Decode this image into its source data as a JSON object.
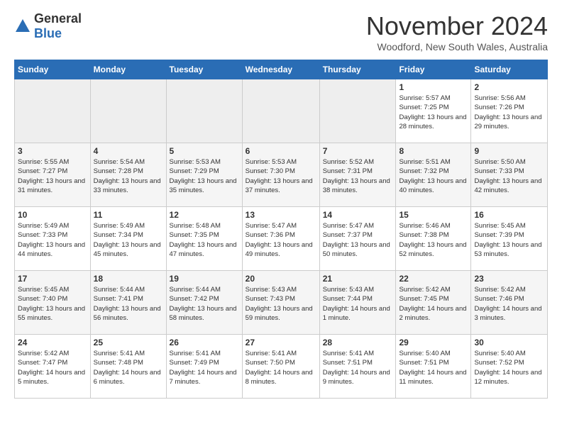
{
  "header": {
    "logo_general": "General",
    "logo_blue": "Blue",
    "month_title": "November 2024",
    "subtitle": "Woodford, New South Wales, Australia"
  },
  "weekdays": [
    "Sunday",
    "Monday",
    "Tuesday",
    "Wednesday",
    "Thursday",
    "Friday",
    "Saturday"
  ],
  "weeks": [
    [
      {
        "day": "",
        "detail": ""
      },
      {
        "day": "",
        "detail": ""
      },
      {
        "day": "",
        "detail": ""
      },
      {
        "day": "",
        "detail": ""
      },
      {
        "day": "",
        "detail": ""
      },
      {
        "day": "1",
        "detail": "Sunrise: 5:57 AM\nSunset: 7:25 PM\nDaylight: 13 hours\nand 28 minutes."
      },
      {
        "day": "2",
        "detail": "Sunrise: 5:56 AM\nSunset: 7:26 PM\nDaylight: 13 hours\nand 29 minutes."
      }
    ],
    [
      {
        "day": "3",
        "detail": "Sunrise: 5:55 AM\nSunset: 7:27 PM\nDaylight: 13 hours\nand 31 minutes."
      },
      {
        "day": "4",
        "detail": "Sunrise: 5:54 AM\nSunset: 7:28 PM\nDaylight: 13 hours\nand 33 minutes."
      },
      {
        "day": "5",
        "detail": "Sunrise: 5:53 AM\nSunset: 7:29 PM\nDaylight: 13 hours\nand 35 minutes."
      },
      {
        "day": "6",
        "detail": "Sunrise: 5:53 AM\nSunset: 7:30 PM\nDaylight: 13 hours\nand 37 minutes."
      },
      {
        "day": "7",
        "detail": "Sunrise: 5:52 AM\nSunset: 7:31 PM\nDaylight: 13 hours\nand 38 minutes."
      },
      {
        "day": "8",
        "detail": "Sunrise: 5:51 AM\nSunset: 7:32 PM\nDaylight: 13 hours\nand 40 minutes."
      },
      {
        "day": "9",
        "detail": "Sunrise: 5:50 AM\nSunset: 7:33 PM\nDaylight: 13 hours\nand 42 minutes."
      }
    ],
    [
      {
        "day": "10",
        "detail": "Sunrise: 5:49 AM\nSunset: 7:33 PM\nDaylight: 13 hours\nand 44 minutes."
      },
      {
        "day": "11",
        "detail": "Sunrise: 5:49 AM\nSunset: 7:34 PM\nDaylight: 13 hours\nand 45 minutes."
      },
      {
        "day": "12",
        "detail": "Sunrise: 5:48 AM\nSunset: 7:35 PM\nDaylight: 13 hours\nand 47 minutes."
      },
      {
        "day": "13",
        "detail": "Sunrise: 5:47 AM\nSunset: 7:36 PM\nDaylight: 13 hours\nand 49 minutes."
      },
      {
        "day": "14",
        "detail": "Sunrise: 5:47 AM\nSunset: 7:37 PM\nDaylight: 13 hours\nand 50 minutes."
      },
      {
        "day": "15",
        "detail": "Sunrise: 5:46 AM\nSunset: 7:38 PM\nDaylight: 13 hours\nand 52 minutes."
      },
      {
        "day": "16",
        "detail": "Sunrise: 5:45 AM\nSunset: 7:39 PM\nDaylight: 13 hours\nand 53 minutes."
      }
    ],
    [
      {
        "day": "17",
        "detail": "Sunrise: 5:45 AM\nSunset: 7:40 PM\nDaylight: 13 hours\nand 55 minutes."
      },
      {
        "day": "18",
        "detail": "Sunrise: 5:44 AM\nSunset: 7:41 PM\nDaylight: 13 hours\nand 56 minutes."
      },
      {
        "day": "19",
        "detail": "Sunrise: 5:44 AM\nSunset: 7:42 PM\nDaylight: 13 hours\nand 58 minutes."
      },
      {
        "day": "20",
        "detail": "Sunrise: 5:43 AM\nSunset: 7:43 PM\nDaylight: 13 hours\nand 59 minutes."
      },
      {
        "day": "21",
        "detail": "Sunrise: 5:43 AM\nSunset: 7:44 PM\nDaylight: 14 hours\nand 1 minute."
      },
      {
        "day": "22",
        "detail": "Sunrise: 5:42 AM\nSunset: 7:45 PM\nDaylight: 14 hours\nand 2 minutes."
      },
      {
        "day": "23",
        "detail": "Sunrise: 5:42 AM\nSunset: 7:46 PM\nDaylight: 14 hours\nand 3 minutes."
      }
    ],
    [
      {
        "day": "24",
        "detail": "Sunrise: 5:42 AM\nSunset: 7:47 PM\nDaylight: 14 hours\nand 5 minutes."
      },
      {
        "day": "25",
        "detail": "Sunrise: 5:41 AM\nSunset: 7:48 PM\nDaylight: 14 hours\nand 6 minutes."
      },
      {
        "day": "26",
        "detail": "Sunrise: 5:41 AM\nSunset: 7:49 PM\nDaylight: 14 hours\nand 7 minutes."
      },
      {
        "day": "27",
        "detail": "Sunrise: 5:41 AM\nSunset: 7:50 PM\nDaylight: 14 hours\nand 8 minutes."
      },
      {
        "day": "28",
        "detail": "Sunrise: 5:41 AM\nSunset: 7:51 PM\nDaylight: 14 hours\nand 9 minutes."
      },
      {
        "day": "29",
        "detail": "Sunrise: 5:40 AM\nSunset: 7:51 PM\nDaylight: 14 hours\nand 11 minutes."
      },
      {
        "day": "30",
        "detail": "Sunrise: 5:40 AM\nSunset: 7:52 PM\nDaylight: 14 hours\nand 12 minutes."
      }
    ]
  ]
}
